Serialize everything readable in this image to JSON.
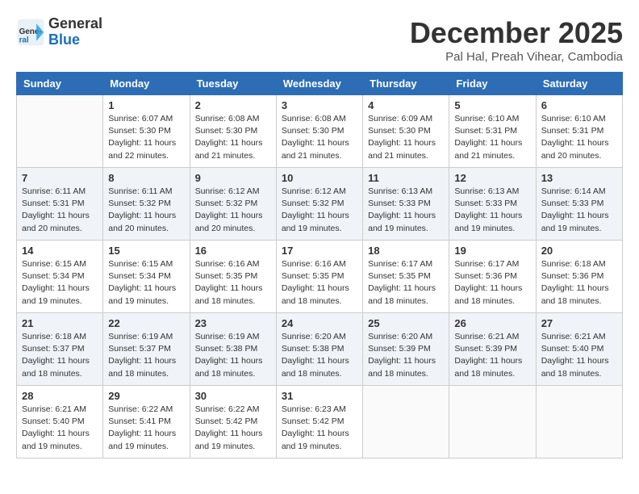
{
  "header": {
    "logo_general": "General",
    "logo_blue": "Blue",
    "month_title": "December 2025",
    "location": "Pal Hal, Preah Vihear, Cambodia"
  },
  "days_of_week": [
    "Sunday",
    "Monday",
    "Tuesday",
    "Wednesday",
    "Thursday",
    "Friday",
    "Saturday"
  ],
  "weeks": [
    [
      {
        "day": "",
        "info": ""
      },
      {
        "day": "1",
        "info": "Sunrise: 6:07 AM\nSunset: 5:30 PM\nDaylight: 11 hours\nand 22 minutes."
      },
      {
        "day": "2",
        "info": "Sunrise: 6:08 AM\nSunset: 5:30 PM\nDaylight: 11 hours\nand 21 minutes."
      },
      {
        "day": "3",
        "info": "Sunrise: 6:08 AM\nSunset: 5:30 PM\nDaylight: 11 hours\nand 21 minutes."
      },
      {
        "day": "4",
        "info": "Sunrise: 6:09 AM\nSunset: 5:30 PM\nDaylight: 11 hours\nand 21 minutes."
      },
      {
        "day": "5",
        "info": "Sunrise: 6:10 AM\nSunset: 5:31 PM\nDaylight: 11 hours\nand 21 minutes."
      },
      {
        "day": "6",
        "info": "Sunrise: 6:10 AM\nSunset: 5:31 PM\nDaylight: 11 hours\nand 20 minutes."
      }
    ],
    [
      {
        "day": "7",
        "info": "Sunrise: 6:11 AM\nSunset: 5:31 PM\nDaylight: 11 hours\nand 20 minutes."
      },
      {
        "day": "8",
        "info": "Sunrise: 6:11 AM\nSunset: 5:32 PM\nDaylight: 11 hours\nand 20 minutes."
      },
      {
        "day": "9",
        "info": "Sunrise: 6:12 AM\nSunset: 5:32 PM\nDaylight: 11 hours\nand 20 minutes."
      },
      {
        "day": "10",
        "info": "Sunrise: 6:12 AM\nSunset: 5:32 PM\nDaylight: 11 hours\nand 19 minutes."
      },
      {
        "day": "11",
        "info": "Sunrise: 6:13 AM\nSunset: 5:33 PM\nDaylight: 11 hours\nand 19 minutes."
      },
      {
        "day": "12",
        "info": "Sunrise: 6:13 AM\nSunset: 5:33 PM\nDaylight: 11 hours\nand 19 minutes."
      },
      {
        "day": "13",
        "info": "Sunrise: 6:14 AM\nSunset: 5:33 PM\nDaylight: 11 hours\nand 19 minutes."
      }
    ],
    [
      {
        "day": "14",
        "info": "Sunrise: 6:15 AM\nSunset: 5:34 PM\nDaylight: 11 hours\nand 19 minutes."
      },
      {
        "day": "15",
        "info": "Sunrise: 6:15 AM\nSunset: 5:34 PM\nDaylight: 11 hours\nand 19 minutes."
      },
      {
        "day": "16",
        "info": "Sunrise: 6:16 AM\nSunset: 5:35 PM\nDaylight: 11 hours\nand 18 minutes."
      },
      {
        "day": "17",
        "info": "Sunrise: 6:16 AM\nSunset: 5:35 PM\nDaylight: 11 hours\nand 18 minutes."
      },
      {
        "day": "18",
        "info": "Sunrise: 6:17 AM\nSunset: 5:35 PM\nDaylight: 11 hours\nand 18 minutes."
      },
      {
        "day": "19",
        "info": "Sunrise: 6:17 AM\nSunset: 5:36 PM\nDaylight: 11 hours\nand 18 minutes."
      },
      {
        "day": "20",
        "info": "Sunrise: 6:18 AM\nSunset: 5:36 PM\nDaylight: 11 hours\nand 18 minutes."
      }
    ],
    [
      {
        "day": "21",
        "info": "Sunrise: 6:18 AM\nSunset: 5:37 PM\nDaylight: 11 hours\nand 18 minutes."
      },
      {
        "day": "22",
        "info": "Sunrise: 6:19 AM\nSunset: 5:37 PM\nDaylight: 11 hours\nand 18 minutes."
      },
      {
        "day": "23",
        "info": "Sunrise: 6:19 AM\nSunset: 5:38 PM\nDaylight: 11 hours\nand 18 minutes."
      },
      {
        "day": "24",
        "info": "Sunrise: 6:20 AM\nSunset: 5:38 PM\nDaylight: 11 hours\nand 18 minutes."
      },
      {
        "day": "25",
        "info": "Sunrise: 6:20 AM\nSunset: 5:39 PM\nDaylight: 11 hours\nand 18 minutes."
      },
      {
        "day": "26",
        "info": "Sunrise: 6:21 AM\nSunset: 5:39 PM\nDaylight: 11 hours\nand 18 minutes."
      },
      {
        "day": "27",
        "info": "Sunrise: 6:21 AM\nSunset: 5:40 PM\nDaylight: 11 hours\nand 18 minutes."
      }
    ],
    [
      {
        "day": "28",
        "info": "Sunrise: 6:21 AM\nSunset: 5:40 PM\nDaylight: 11 hours\nand 19 minutes."
      },
      {
        "day": "29",
        "info": "Sunrise: 6:22 AM\nSunset: 5:41 PM\nDaylight: 11 hours\nand 19 minutes."
      },
      {
        "day": "30",
        "info": "Sunrise: 6:22 AM\nSunset: 5:42 PM\nDaylight: 11 hours\nand 19 minutes."
      },
      {
        "day": "31",
        "info": "Sunrise: 6:23 AM\nSunset: 5:42 PM\nDaylight: 11 hours\nand 19 minutes."
      },
      {
        "day": "",
        "info": ""
      },
      {
        "day": "",
        "info": ""
      },
      {
        "day": "",
        "info": ""
      }
    ]
  ]
}
